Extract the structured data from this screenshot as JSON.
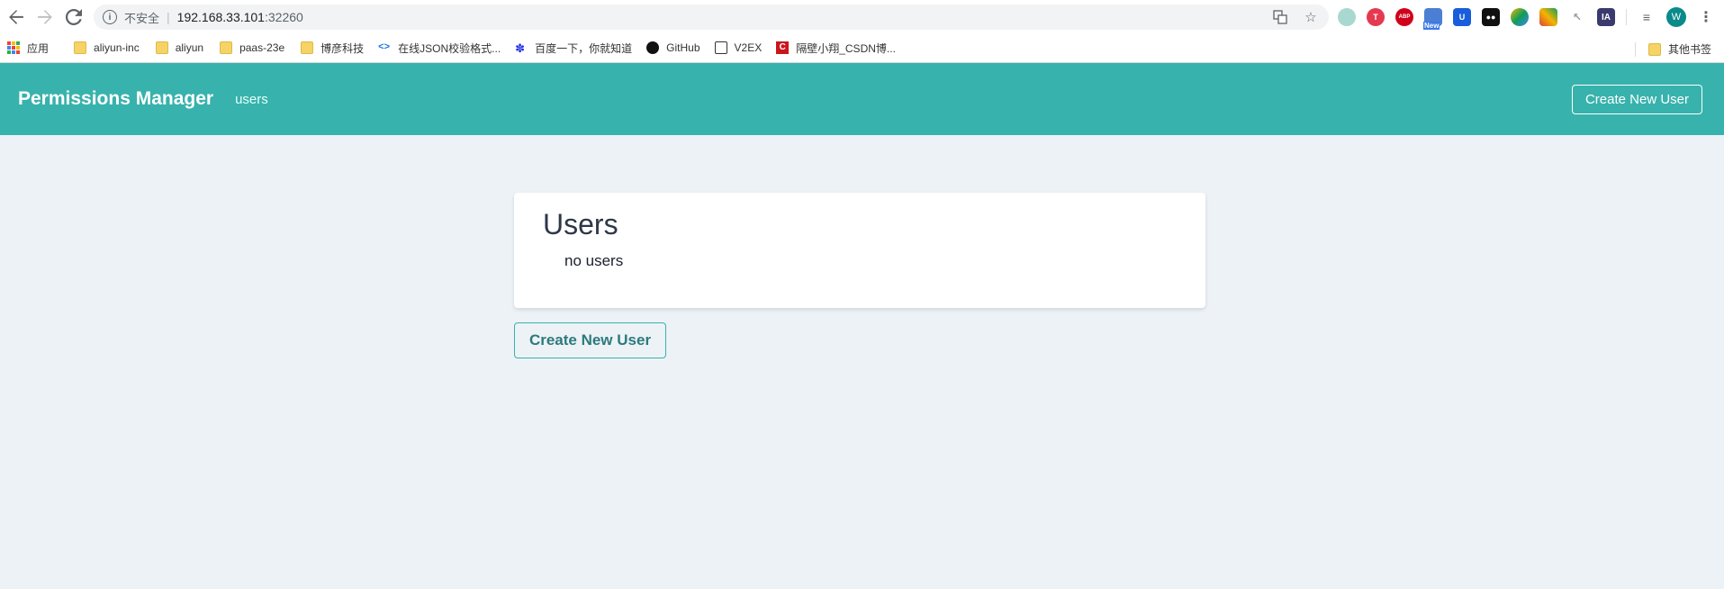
{
  "browser": {
    "security_label": "不安全",
    "url_host": "192.168.33.101",
    "url_port": ":32260",
    "bookmarks": [
      {
        "label": "应用",
        "icon": "apps-icon"
      },
      {
        "label": "aliyun-inc",
        "icon": "folder-icon"
      },
      {
        "label": "aliyun",
        "icon": "folder-icon"
      },
      {
        "label": "paas-23e",
        "icon": "folder-icon"
      },
      {
        "label": "博彦科技",
        "icon": "folder-icon"
      },
      {
        "label": "在线JSON校验格式...",
        "icon": "code-icon"
      },
      {
        "label": "百度一下，你就知道",
        "icon": "baidu-icon"
      },
      {
        "label": "GitHub",
        "icon": "github-icon"
      },
      {
        "label": "V2EX",
        "icon": "v2ex-icon"
      },
      {
        "label": "隔壁小翔_CSDN博...",
        "icon": "csdn-icon"
      }
    ],
    "other_bookmarks": "其他书签",
    "profile_initial": "W",
    "ext_new_badge": "New",
    "ext_abp": "ABP",
    "ext_ia": "IA"
  },
  "header": {
    "brand": "Permissions Manager",
    "nav_users": "users",
    "create_button": "Create New User",
    "color": "#38b2ac"
  },
  "main": {
    "title": "Users",
    "empty_text": "no users",
    "create_button": "Create New User"
  }
}
